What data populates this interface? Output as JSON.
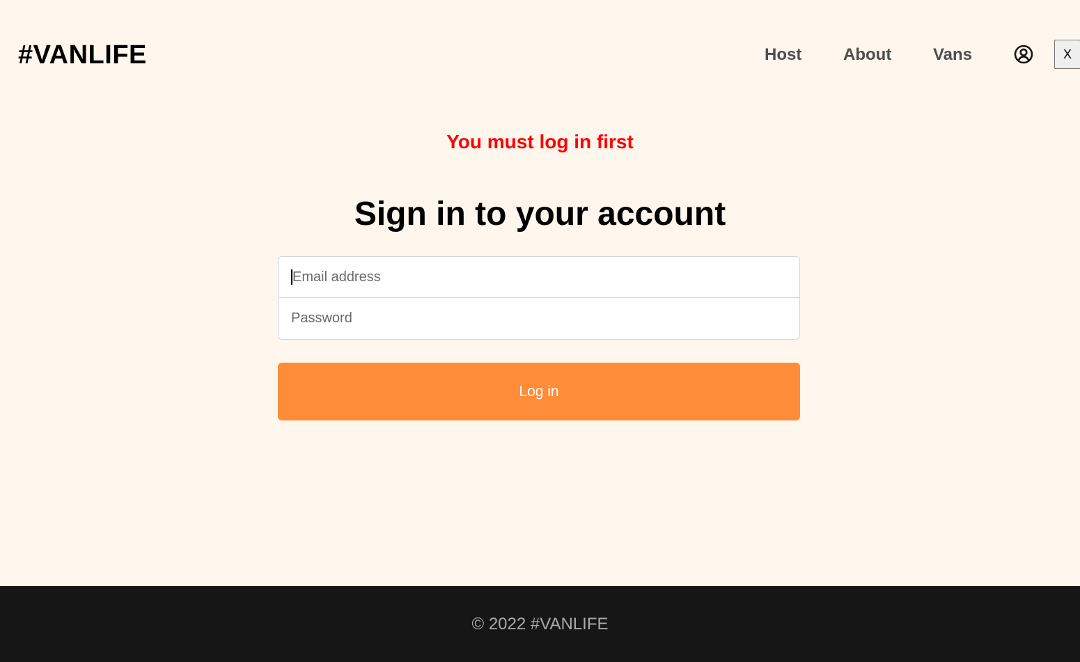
{
  "header": {
    "logo": "#VANLIFE",
    "nav": {
      "host": "Host",
      "about": "About",
      "vans": "Vans"
    },
    "avatar_icon": "user-circle-icon",
    "logout_label": "X"
  },
  "main": {
    "error_message": "You must log in first",
    "title": "Sign in to your account",
    "form": {
      "email_placeholder": "Email address",
      "email_value": "",
      "password_placeholder": "Password",
      "password_value": "",
      "submit_label": "Log in"
    }
  },
  "footer": {
    "text": "© 2022 #VANLIFE"
  },
  "colors": {
    "background": "#FFF7ED",
    "accent": "#FF8C38",
    "error": "#FF0000",
    "footer_bg": "#161616"
  }
}
